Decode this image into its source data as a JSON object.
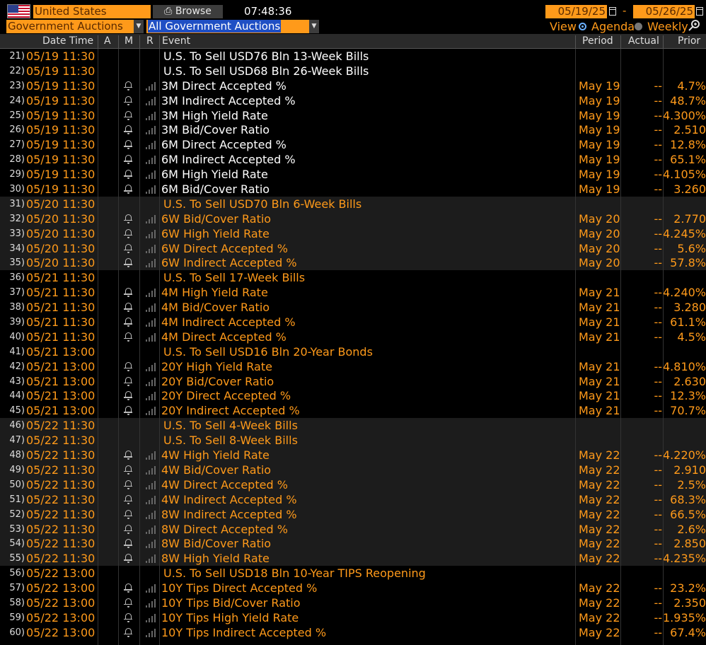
{
  "header": {
    "country": "United States",
    "browse_label": "Browse",
    "time": "07:48:36",
    "date_start": "05/19/25",
    "date_end": "05/26/25",
    "date_sep": "-"
  },
  "filters": {
    "category": "Government Auctions",
    "subcategory": "All Government Auctions",
    "view_label": "View",
    "agenda_label": "Agenda",
    "weekly_label": "Weekly",
    "selected_view": "Agenda"
  },
  "columns": {
    "date_time": "Date Time",
    "a": "A",
    "m": "M",
    "r": "R",
    "event": "Event",
    "period": "Period",
    "actual": "Actual",
    "prior": "Prior"
  },
  "colors": {
    "accent": "#ff9a1a",
    "header_white": "#ffffff",
    "shade": "#1c1c1c"
  },
  "rows": [
    {
      "n": "21)",
      "dt": "05/19 11:30",
      "ev": "U.S. To Sell USD76 Bln 13-Week Bills",
      "hdr": true,
      "per": "",
      "act": "",
      "pri": "",
      "white": true
    },
    {
      "n": "22)",
      "dt": "05/19 11:30",
      "ev": "U.S. To Sell USD68 Bln 26-Week Bills",
      "hdr": true,
      "per": "",
      "act": "",
      "pri": "",
      "white": true
    },
    {
      "n": "23)",
      "dt": "05/19 11:30",
      "ev": "3M Direct Accepted %",
      "per": "May 19",
      "act": "--",
      "pri": "4.7%",
      "white": true
    },
    {
      "n": "24)",
      "dt": "05/19 11:30",
      "ev": "3M Indirect Accepted %",
      "per": "May 19",
      "act": "--",
      "pri": "48.7%",
      "white": true
    },
    {
      "n": "25)",
      "dt": "05/19 11:30",
      "ev": "3M High Yield Rate",
      "per": "May 19",
      "act": "--",
      "pri": "4.300%",
      "white": true
    },
    {
      "n": "26)",
      "dt": "05/19 11:30",
      "ev": "3M Bid/Cover Ratio",
      "per": "May 19",
      "act": "--",
      "pri": "2.510",
      "white": true
    },
    {
      "n": "27)",
      "dt": "05/19 11:30",
      "ev": "6M Direct Accepted %",
      "per": "May 19",
      "act": "--",
      "pri": "12.8%",
      "white": true
    },
    {
      "n": "28)",
      "dt": "05/19 11:30",
      "ev": "6M Indirect Accepted %",
      "per": "May 19",
      "act": "--",
      "pri": "65.1%",
      "white": true
    },
    {
      "n": "29)",
      "dt": "05/19 11:30",
      "ev": "6M High Yield Rate",
      "per": "May 19",
      "act": "--",
      "pri": "4.105%",
      "white": true
    },
    {
      "n": "30)",
      "dt": "05/19 11:30",
      "ev": "6M Bid/Cover Ratio",
      "per": "May 19",
      "act": "--",
      "pri": "3.260",
      "white": true
    },
    {
      "n": "31)",
      "dt": "05/20 11:30",
      "ev": "U.S. To Sell USD70 Bln 6-Week Bills",
      "hdr": true,
      "per": "",
      "act": "",
      "pri": "",
      "shade": true
    },
    {
      "n": "32)",
      "dt": "05/20 11:30",
      "ev": "6W Bid/Cover Ratio",
      "per": "May 20",
      "act": "--",
      "pri": "2.770",
      "shade": true
    },
    {
      "n": "33)",
      "dt": "05/20 11:30",
      "ev": "6W High Yield Rate",
      "per": "May 20",
      "act": "--",
      "pri": "4.245%",
      "shade": true
    },
    {
      "n": "34)",
      "dt": "05/20 11:30",
      "ev": "6W Direct Accepted %",
      "per": "May 20",
      "act": "--",
      "pri": "5.6%",
      "shade": true
    },
    {
      "n": "35)",
      "dt": "05/20 11:30",
      "ev": "6W Indirect Accepted %",
      "per": "May 20",
      "act": "--",
      "pri": "57.8%",
      "shade": true
    },
    {
      "n": "36)",
      "dt": "05/21 11:30",
      "ev": "U.S. To Sell 17-Week Bills",
      "hdr": true,
      "per": "",
      "act": "",
      "pri": ""
    },
    {
      "n": "37)",
      "dt": "05/21 11:30",
      "ev": "4M High Yield Rate",
      "per": "May 21",
      "act": "--",
      "pri": "4.240%"
    },
    {
      "n": "38)",
      "dt": "05/21 11:30",
      "ev": "4M Bid/Cover Ratio",
      "per": "May 21",
      "act": "--",
      "pri": "3.280"
    },
    {
      "n": "39)",
      "dt": "05/21 11:30",
      "ev": "4M Indirect Accepted %",
      "per": "May 21",
      "act": "--",
      "pri": "61.1%"
    },
    {
      "n": "40)",
      "dt": "05/21 11:30",
      "ev": "4M Direct Accepted %",
      "per": "May 21",
      "act": "--",
      "pri": "4.5%"
    },
    {
      "n": "41)",
      "dt": "05/21 13:00",
      "ev": "U.S. To Sell USD16 Bln 20-Year Bonds",
      "hdr": true,
      "per": "",
      "act": "",
      "pri": ""
    },
    {
      "n": "42)",
      "dt": "05/21 13:00",
      "ev": "20Y High Yield Rate",
      "per": "May 21",
      "act": "--",
      "pri": "4.810%"
    },
    {
      "n": "43)",
      "dt": "05/21 13:00",
      "ev": "20Y Bid/Cover Ratio",
      "per": "May 21",
      "act": "--",
      "pri": "2.630"
    },
    {
      "n": "44)",
      "dt": "05/21 13:00",
      "ev": "20Y Direct Accepted %",
      "per": "May 21",
      "act": "--",
      "pri": "12.3%"
    },
    {
      "n": "45)",
      "dt": "05/21 13:00",
      "ev": "20Y Indirect Accepted %",
      "per": "May 21",
      "act": "--",
      "pri": "70.7%"
    },
    {
      "n": "46)",
      "dt": "05/22 11:30",
      "ev": "U.S. To Sell 4-Week Bills",
      "hdr": true,
      "per": "",
      "act": "",
      "pri": "",
      "shade": true
    },
    {
      "n": "47)",
      "dt": "05/22 11:30",
      "ev": "U.S. To Sell 8-Week Bills",
      "hdr": true,
      "per": "",
      "act": "",
      "pri": "",
      "shade": true
    },
    {
      "n": "48)",
      "dt": "05/22 11:30",
      "ev": "4W High Yield Rate",
      "per": "May 22",
      "act": "--",
      "pri": "4.220%",
      "shade": true
    },
    {
      "n": "49)",
      "dt": "05/22 11:30",
      "ev": "4W Bid/Cover Ratio",
      "per": "May 22",
      "act": "--",
      "pri": "2.910",
      "shade": true
    },
    {
      "n": "50)",
      "dt": "05/22 11:30",
      "ev": "4W Direct Accepted %",
      "per": "May 22",
      "act": "--",
      "pri": "2.5%",
      "shade": true
    },
    {
      "n": "51)",
      "dt": "05/22 11:30",
      "ev": "4W Indirect Accepted %",
      "per": "May 22",
      "act": "--",
      "pri": "68.3%",
      "shade": true
    },
    {
      "n": "52)",
      "dt": "05/22 11:30",
      "ev": "8W Indirect Accepted %",
      "per": "May 22",
      "act": "--",
      "pri": "66.5%",
      "shade": true
    },
    {
      "n": "53)",
      "dt": "05/22 11:30",
      "ev": "8W Direct Accepted %",
      "per": "May 22",
      "act": "--",
      "pri": "2.6%",
      "shade": true
    },
    {
      "n": "54)",
      "dt": "05/22 11:30",
      "ev": "8W Bid/Cover Ratio",
      "per": "May 22",
      "act": "--",
      "pri": "2.850",
      "shade": true
    },
    {
      "n": "55)",
      "dt": "05/22 11:30",
      "ev": "8W High Yield Rate",
      "per": "May 22",
      "act": "--",
      "pri": "4.235%",
      "shade": true
    },
    {
      "n": "56)",
      "dt": "05/22 13:00",
      "ev": "U.S. To Sell USD18 Bln 10-Year TIPS Reopening",
      "hdr": true,
      "per": "",
      "act": "",
      "pri": ""
    },
    {
      "n": "57)",
      "dt": "05/22 13:00",
      "ev": "10Y Tips Direct Accepted %",
      "per": "May 22",
      "act": "--",
      "pri": "23.2%"
    },
    {
      "n": "58)",
      "dt": "05/22 13:00",
      "ev": "10Y Tips Bid/Cover Ratio",
      "per": "May 22",
      "act": "--",
      "pri": "2.350"
    },
    {
      "n": "59)",
      "dt": "05/22 13:00",
      "ev": "10Y Tips High Yield Rate",
      "per": "May 22",
      "act": "--",
      "pri": "1.935%"
    },
    {
      "n": "60)",
      "dt": "05/22 13:00",
      "ev": "10Y Tips Indirect Accepted %",
      "per": "May 22",
      "act": "--",
      "pri": "67.4%"
    }
  ]
}
